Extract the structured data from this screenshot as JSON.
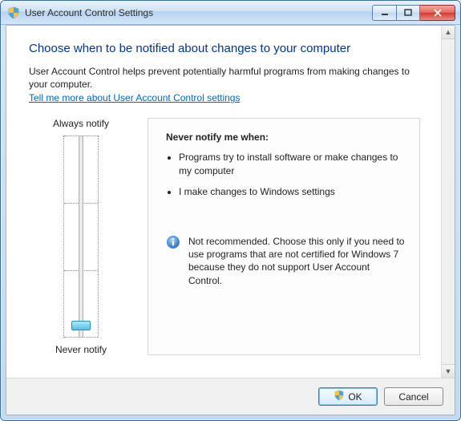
{
  "titlebar": {
    "title": "User Account Control Settings"
  },
  "content": {
    "heading": "Choose when to be notified about changes to your computer",
    "intro": "User Account Control helps prevent potentially harmful programs from making changes to your computer.",
    "help_link": "Tell me more about User Account Control settings"
  },
  "slider": {
    "top_label": "Always notify",
    "bottom_label": "Never notify"
  },
  "description": {
    "title": "Never notify me when:",
    "bullets": [
      "Programs try to install software or make changes to my computer",
      "I make changes to Windows settings"
    ],
    "info_text": "Not recommended. Choose this only if you need to use programs that are not certified for Windows 7 because they do not support User Account Control."
  },
  "buttons": {
    "ok": "OK",
    "cancel": "Cancel"
  }
}
